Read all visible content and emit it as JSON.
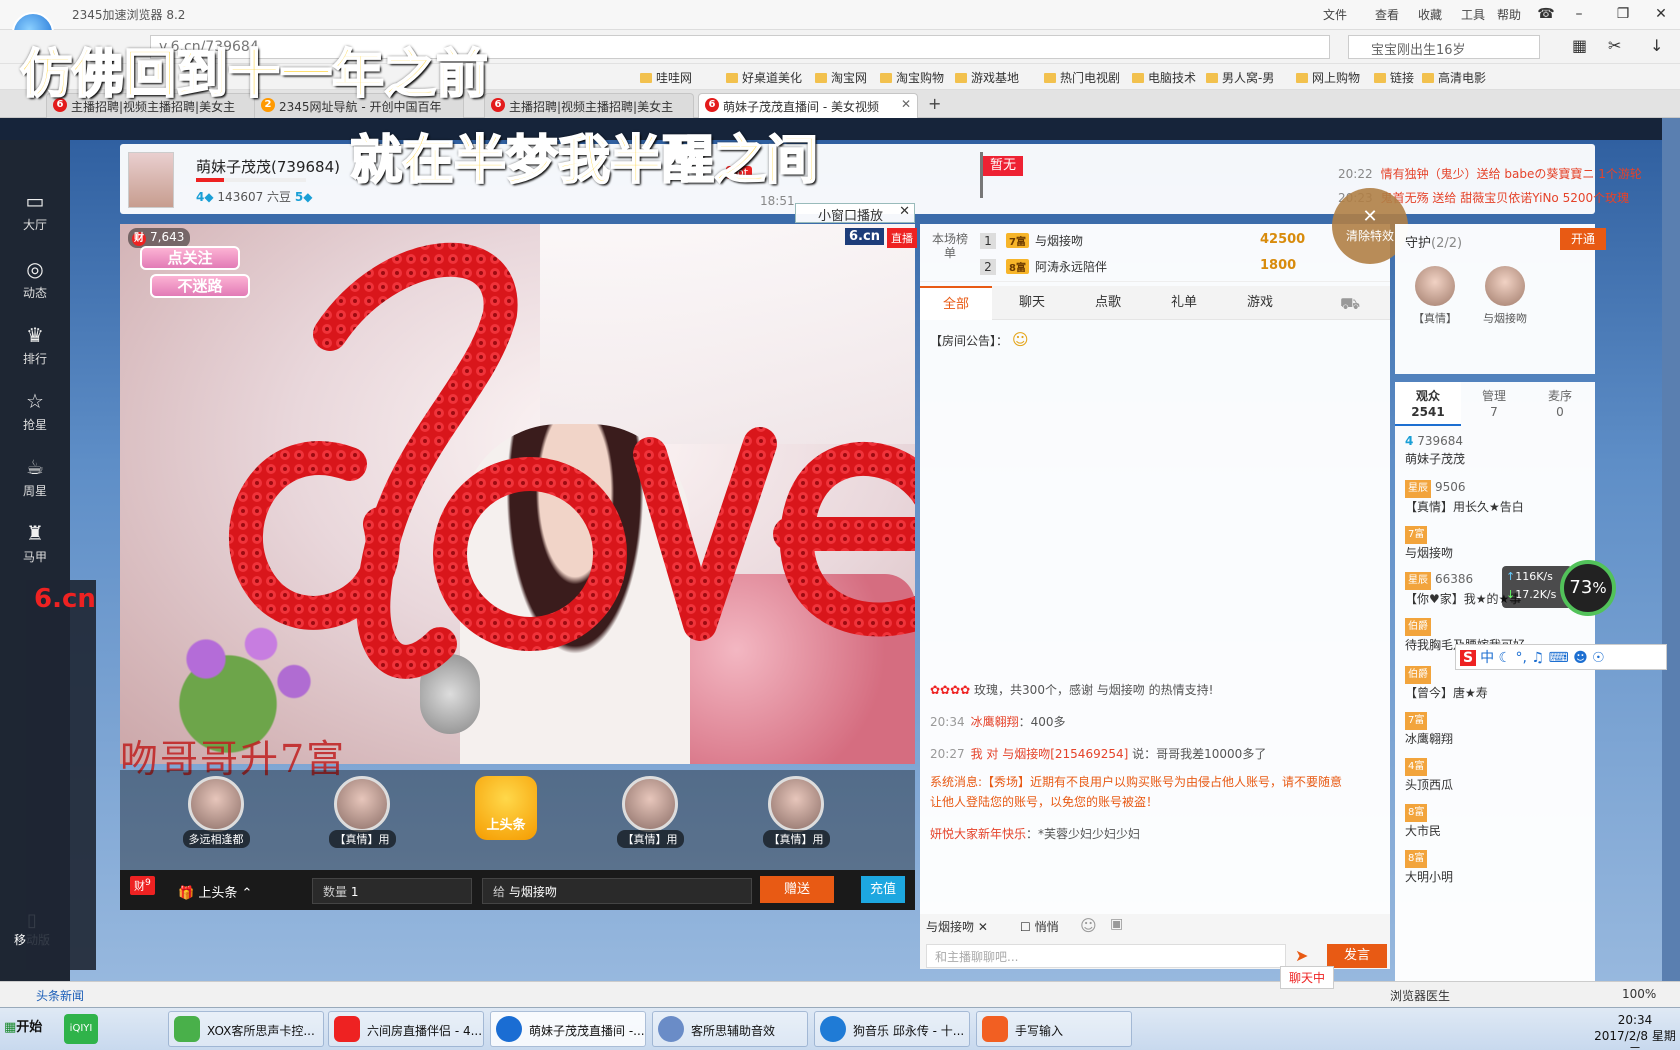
{
  "browser": {
    "title": "2345加速浏览器 8.2",
    "menu": [
      "文件",
      "查看",
      "收藏",
      "工具",
      "帮助"
    ],
    "address": "v.6.cn/739684",
    "search_placeholder": "宝宝刚出生16岁",
    "bookmarks": [
      "哇哇网",
      "好桌道美化",
      "淘宝网",
      "淘宝购物",
      "游戏基地",
      "热门电视剧",
      "电脑技术",
      "男人窝-男",
      "网上购物",
      "链接",
      "高清电影"
    ],
    "tabs": [
      {
        "label": "主播招聘|视频主播招聘|美女主"
      },
      {
        "label": "2345网址导航 - 开创中国百年"
      },
      {
        "label": "主播招聘|视频主播招聘|美女主"
      },
      {
        "label": "萌妹子茂茂直播间 - 美女视频"
      }
    ]
  },
  "overlay": {
    "lyric_line1": "仿佛回到十一年之前",
    "lyric_line2": "就在半梦我半醒之间"
  },
  "sidebar": {
    "items": [
      {
        "label": "大厅",
        "icon": "tv-icon"
      },
      {
        "label": "动态",
        "icon": "compass-icon"
      },
      {
        "label": "排行",
        "icon": "crown-icon"
      },
      {
        "label": "抢星",
        "icon": "star-icon"
      },
      {
        "label": "周星",
        "icon": "cup-icon"
      },
      {
        "label": "马甲",
        "icon": "shirt-icon"
      }
    ],
    "mobile_label": "移动版"
  },
  "room": {
    "anchor_name": "萌妹子茂茂(739684)",
    "level_badge": "4",
    "beans": "143607 六豆",
    "fans_badge": "5",
    "news": [
      {
        "time": "20:22",
        "text": "情有独钟（鬼少）送给 babeの葵寶寶ニ 1个游轮"
      },
      {
        "time": "20:23",
        "text": "鬼首无殇 送给 甜薇宝贝依诺YiNo 5200个玫瑰"
      }
    ],
    "flag_label": "暂无",
    "hot_label": "hot",
    "time_label": "18:51"
  },
  "video": {
    "viewer_count": "7,643",
    "brand": "6.cn",
    "live_label": "直播",
    "popout_label": "小窗口播放",
    "sticker_line1": "点关注",
    "sticker_line2": "不迷路",
    "banner_text": "吻哥哥升7富"
  },
  "giftrow": [
    {
      "label": "多远相逢都"
    },
    {
      "label": "【真情】用"
    },
    {
      "label": "上头条"
    },
    {
      "label": "【真情】用"
    },
    {
      "label": "【真情】用"
    }
  ],
  "giftbar": {
    "headline_label": "上头条",
    "qty_label": "数量",
    "qty_value": "1",
    "to_label": "给",
    "to_value": "与烟接吻",
    "send_label": "赠送",
    "recharge_label": "充值",
    "badge_count": "9"
  },
  "rank": {
    "title": "本场榜单",
    "rows": [
      {
        "no": "1",
        "lv": "7富",
        "name": "与烟接吻",
        "coins": "42500"
      },
      {
        "no": "2",
        "lv": "8富",
        "name": "阿涛永远陪伴",
        "coins": "1800"
      }
    ]
  },
  "chat": {
    "tabs": [
      "全部",
      "聊天",
      "点歌",
      "礼单",
      "游戏"
    ],
    "announce": "【房间公告】：",
    "messages": [
      {
        "time": "",
        "nick": "与烟接吻",
        "text": "玫瑰，共300个，感谢 与烟接吻 的热情支持!",
        "sys": false
      },
      {
        "time": "20:34",
        "nick": "冰鹰翱翔",
        "text": "：400多",
        "sys": false
      },
      {
        "time": "20:27",
        "nick": "我 对 与烟接吻[215469254]",
        "text": "说：哥哥我差10000多了",
        "sys": false
      },
      {
        "time": "",
        "nick": "",
        "text": "系统消息:【秀场】近期有不良用户以购买账号为由侵占他人账号，请不要随意让他人登陆您的账号，以免您的账号被盗！",
        "sys": true
      },
      {
        "time": "",
        "nick": "妍悦大家新年快乐",
        "text": "：*芙蓉少妇少妇少妇",
        "sys": false
      }
    ],
    "to_user": "与烟接吻",
    "whisper_label": "悄悄",
    "input_placeholder": "和主播聊聊吧...",
    "send_label": "发言"
  },
  "clear_effects": "清除特效",
  "guard": {
    "title": "守护",
    "count": "(2/2)",
    "open_label": "开通",
    "members": [
      "【真情】",
      "与烟接吻"
    ]
  },
  "audience": {
    "tabs": [
      {
        "label": "观众",
        "count": "2541"
      },
      {
        "label": "管理",
        "count": "7"
      },
      {
        "label": "麦序",
        "count": "0"
      }
    ],
    "items": [
      {
        "badge": "4",
        "id": "739684",
        "name": "萌妹子茂茂"
      },
      {
        "badge": "星辰",
        "id": "9506",
        "name": "【真情】用长久★告白"
      },
      {
        "badge": "7富",
        "id": "",
        "name": "与烟接吻"
      },
      {
        "badge": "星辰",
        "id": "66386",
        "name": "【你♥家】我★的★事"
      },
      {
        "badge": "伯爵",
        "id": "",
        "name": "待我胸毛及腰嫁我可好"
      },
      {
        "badge": "伯爵",
        "id": "",
        "name": "【曾今】唐★寿"
      },
      {
        "badge": "7富",
        "id": "",
        "name": "冰鹰翱翔"
      },
      {
        "badge": "4富",
        "id": "",
        "name": "头顶西瓜"
      },
      {
        "badge": "8富",
        "id": "",
        "name": "大市民"
      },
      {
        "badge": "8富",
        "id": "",
        "name": "大明小明"
      }
    ]
  },
  "netwidget": {
    "up": "116K/s",
    "down": "17.2K/s",
    "percent": "73"
  },
  "statusbar": {
    "left": "头条新闻",
    "doctor": "浏览器医生",
    "zoom": "100%",
    "chat": "聊天中"
  },
  "taskbar": {
    "start": "开始",
    "tasks": [
      "XOX客所思声卡控...",
      "六间房直播伴侣 - 4....",
      "萌妹子茂茂直播间 -...",
      "客所思辅助音效",
      "狗音乐 邱永传 - 十...",
      "手写输入"
    ],
    "time": "20:34",
    "date": "2017/2/8 星期三"
  },
  "colors": {
    "accent": "#e85a14",
    "live_red": "#e22222",
    "sidebar_bg": "#1e2633"
  }
}
